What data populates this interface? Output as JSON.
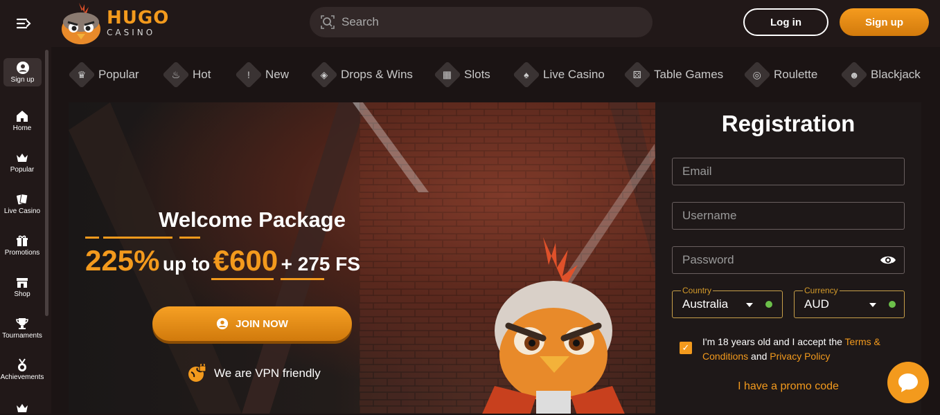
{
  "header": {
    "logo_primary": "HUGO",
    "logo_secondary": "CASINO",
    "search_placeholder": "Search",
    "login_label": "Log in",
    "signup_label": "Sign up"
  },
  "sidebar": {
    "items": [
      {
        "label": "Sign up",
        "icon": "user-icon"
      },
      {
        "label": "Home",
        "icon": "home-icon"
      },
      {
        "label": "Popular",
        "icon": "crown-icon"
      },
      {
        "label": "Live Casino",
        "icon": "cards-icon"
      },
      {
        "label": "Promotions",
        "icon": "gift-icon"
      },
      {
        "label": "Shop",
        "icon": "shop-icon"
      },
      {
        "label": "Tournaments",
        "icon": "trophy-icon"
      },
      {
        "label": "Achievements",
        "icon": "medal-icon"
      }
    ]
  },
  "categories": [
    {
      "label": "Popular",
      "icon": "crown-icon"
    },
    {
      "label": "Hot",
      "icon": "flame-icon"
    },
    {
      "label": "New",
      "icon": "exclamation-icon"
    },
    {
      "label": "Drops & Wins",
      "icon": "drops-icon"
    },
    {
      "label": "Slots",
      "icon": "slots-icon"
    },
    {
      "label": "Live Casino",
      "icon": "cards-icon"
    },
    {
      "label": "Table Games",
      "icon": "dice-icon"
    },
    {
      "label": "Roulette",
      "icon": "roulette-icon"
    },
    {
      "label": "Blackjack",
      "icon": "blackjack-icon"
    }
  ],
  "hero": {
    "title": "Welcome Package",
    "percent": "225%",
    "up_to": "up to",
    "amount": "€600",
    "free_spins": "+ 275 FS",
    "join_label": "JOIN NOW",
    "vpn_text": "We are VPN friendly"
  },
  "registration": {
    "title": "Registration",
    "email_placeholder": "Email",
    "username_placeholder": "Username",
    "password_placeholder": "Password",
    "country_label": "Country",
    "country_value": "Australia",
    "currency_label": "Currency",
    "currency_value": "AUD",
    "terms_prefix": "I'm 18 years old and I accept the",
    "terms_link": "Terms & Conditions",
    "terms_and": "and",
    "privacy_link": "Privacy Policy",
    "promo_link": "I have a promo code"
  },
  "colors": {
    "accent": "#f39a1d",
    "background": "#1b1414",
    "ok": "#6cc04a"
  }
}
